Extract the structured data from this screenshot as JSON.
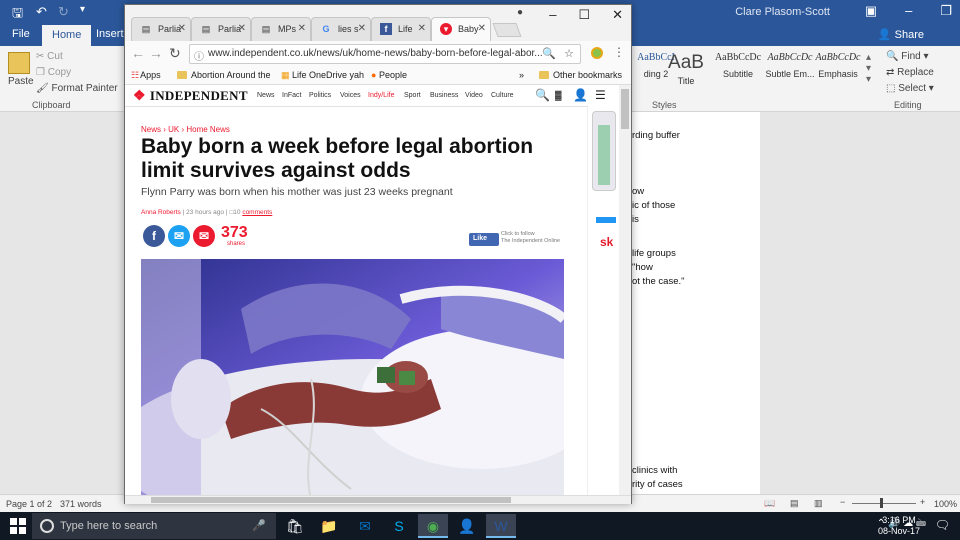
{
  "word": {
    "user": "Clare Plasom-Scott",
    "tabs": [
      "File",
      "Home",
      "Insert"
    ],
    "share_label": "Share",
    "clipboard": {
      "paste": "Paste",
      "cut": "Cut",
      "copy": "Copy",
      "format_painter": "Format Painter",
      "group": "Clipboard"
    },
    "styles": [
      {
        "sample": "AaBbCcI",
        "name": "Heading 2",
        "visible_name": "ding 2"
      },
      {
        "sample": "AaB",
        "name": "Title"
      },
      {
        "sample": "AaBbCcDc",
        "name": "Subtitle"
      },
      {
        "sample": "AaBbCcDc",
        "name": "Subtle Em..."
      },
      {
        "sample": "AaBbCcDc",
        "name": "Emphasis"
      }
    ],
    "styles_group": "Styles",
    "editing": {
      "find": "Find",
      "replace": "Replace",
      "select": "Select",
      "group": "Editing"
    },
    "doc_fragments": [
      "rding buffer",
      "ow",
      "ic of those",
      "is",
      "life groups",
      "\"how",
      "ot the case.\"",
      "clinics with",
      "rity of cases",
      "y taken time"
    ],
    "status": {
      "page": "Page 1 of 2",
      "words": "371 words",
      "zoom": "100%"
    }
  },
  "chrome": {
    "tabs": [
      {
        "title": "Parlia",
        "icon": "document-icon"
      },
      {
        "title": "Parlia",
        "icon": "document-icon"
      },
      {
        "title": "MPs",
        "icon": "document-icon"
      },
      {
        "title": "lies s",
        "icon": "google-icon"
      },
      {
        "title": "Life",
        "icon": "facebook-icon"
      },
      {
        "title": "Baby",
        "icon": "independent-icon",
        "active": true
      }
    ],
    "url": "www.independent.co.uk/news/uk/home-news/baby-born-before-legal-abor...",
    "bookmarks": [
      "Apps",
      "Abortion Around the",
      "Life OneDrive yah",
      "People"
    ],
    "other_bookmarks": "Other bookmarks",
    "overflow": "»"
  },
  "article": {
    "site": "INDEPENDENT",
    "nav": [
      "News",
      "InFact",
      "Politics",
      "Voices",
      "Indy/Life",
      "Sport",
      "Business",
      "Video",
      "Culture"
    ],
    "breadcrumb": "News › UK › Home News",
    "headline": "Baby born a week before legal abortion limit survives against odds",
    "standfirst": "Flynn Parry was born when his mother was just 23 weeks pregnant",
    "author": "Anna Roberts",
    "time": "23 hours ago",
    "comments_count": "10",
    "comments_label": "comments",
    "shares_count": "373",
    "shares_label": "shares",
    "fb_like": "Like",
    "fb_follow": "Click to follow\nThe Independent Online"
  },
  "taskbar": {
    "search_placeholder": "Type here to search",
    "time": "3:16 PM",
    "date": "08-Nov-17"
  },
  "colors": {
    "word_blue": "#2b579a",
    "indy_red": "#ec1a2e",
    "taskbar": "#101823"
  }
}
